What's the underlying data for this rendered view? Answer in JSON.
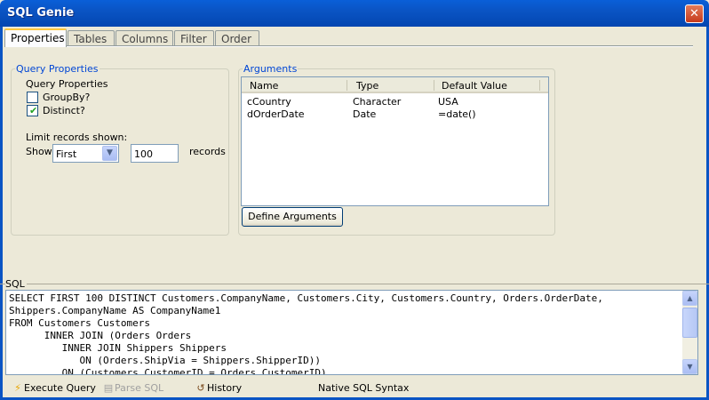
{
  "window": {
    "title": "SQL Genie",
    "close_glyph": "✕"
  },
  "tabs": [
    {
      "label": "Properties",
      "active": true
    },
    {
      "label": "Tables",
      "active": false
    },
    {
      "label": "Columns",
      "active": false
    },
    {
      "label": "Filter",
      "active": false
    },
    {
      "label": "Order",
      "active": false
    }
  ],
  "query_properties": {
    "group_title": "Query Properties",
    "heading": "Query Properties",
    "groupby_label": "GroupBy?",
    "groupby_checked": false,
    "distinct_label": "Distinct?",
    "distinct_checked": true,
    "limit_label": "Limit records shown:",
    "show_label": "Show",
    "show_select_value": "First",
    "records_value": "100",
    "records_label": "records"
  },
  "arguments": {
    "group_title": "Arguments",
    "columns": [
      "Name",
      "Type",
      "Default Value"
    ],
    "rows": [
      {
        "name": "cCountry",
        "type": "Character",
        "default": "USA"
      },
      {
        "name": "dOrderDate",
        "type": "Date",
        "default": "=date()"
      }
    ],
    "define_button": "Define Arguments"
  },
  "sql": {
    "label": "SQL",
    "text": "SELECT FIRST 100 DISTINCT Customers.CompanyName, Customers.City, Customers.Country, Orders.OrderDate,\nShippers.CompanyName AS CompanyName1\nFROM Customers Customers\n      INNER JOIN (Orders Orders\n         INNER JOIN Shippers Shippers\n            ON (Orders.ShipVia = Shippers.ShipperID))\n         ON (Customers.CustomerID = Orders.CustomerID)"
  },
  "bottom_toolbar": {
    "execute": "Execute Query",
    "parse": "Parse SQL",
    "history": "History",
    "native_syntax": "Native SQL Syntax"
  },
  "icons": {
    "execute": "lightning-icon",
    "parse": "document-icon",
    "history": "history-icon"
  },
  "colors": {
    "accent": "#0046d5",
    "titlebar": "#0a54c4",
    "check": "#21a121"
  }
}
